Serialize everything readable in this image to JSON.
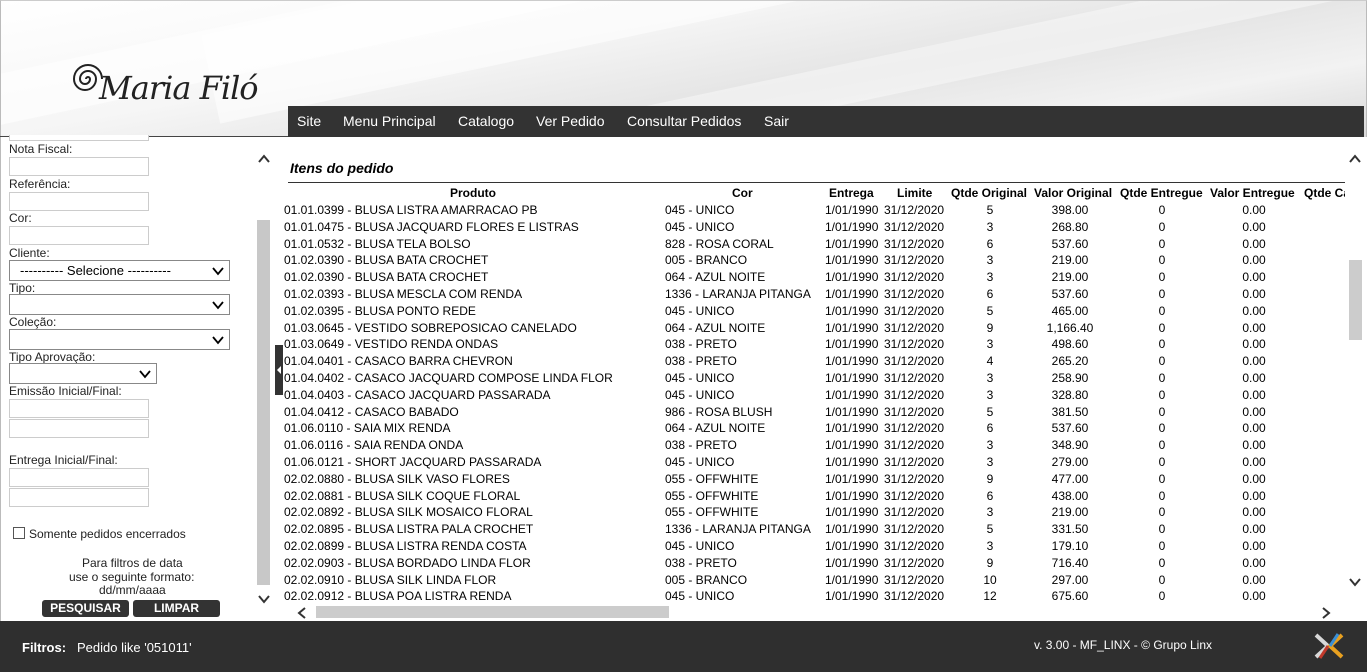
{
  "nav": [
    "Site",
    "Menu Principal",
    "Catalogo",
    "Ver Pedido",
    "Consultar Pedidos",
    "Sair"
  ],
  "logo_text": "Maria Filó",
  "sidebar": {
    "nota_fiscal": "Nota Fiscal:",
    "referencia": "Referência:",
    "cor": "Cor:",
    "cliente": "Cliente:",
    "cliente_value": "---------- Selecione ----------",
    "tipo": "Tipo:",
    "colecao": "Coleção:",
    "tipo_aprovacao": "Tipo Aprovação:",
    "emissao": "Emissão Inicial/Final:",
    "entrega": "Entrega Inicial/Final:",
    "somente": "Somente pedidos encerrados",
    "hint1": "Para filtros de data",
    "hint2": "use o seguinte formato:",
    "hint3": "dd/mm/aaaa",
    "pesquisar": "PESQUISAR",
    "limpar": "LIMPAR"
  },
  "section_title": "Itens do pedido",
  "columns": [
    "Produto",
    "Cor",
    "Entrega",
    "Limite",
    "Qtde Original",
    "Valor Original",
    "Qtde Entregue",
    "Valor Entregue",
    "Qtde Ca"
  ],
  "rows": [
    [
      "01.01.0399 - BLUSA LISTRA AMARRACAO PB",
      "045 - UNICO",
      "1/01/1990",
      "31/12/2020",
      "5",
      "398.00",
      "0",
      "0.00"
    ],
    [
      "01.01.0475 - BLUSA JACQUARD FLORES E LISTRAS",
      "045 - UNICO",
      "1/01/1990",
      "31/12/2020",
      "3",
      "268.80",
      "0",
      "0.00"
    ],
    [
      "01.01.0532 - BLUSA TELA BOLSO",
      "828 - ROSA CORAL",
      "1/01/1990",
      "31/12/2020",
      "6",
      "537.60",
      "0",
      "0.00"
    ],
    [
      "01.02.0390 - BLUSA BATA CROCHET",
      "005 - BRANCO",
      "1/01/1990",
      "31/12/2020",
      "3",
      "219.00",
      "0",
      "0.00"
    ],
    [
      "01.02.0390 - BLUSA BATA CROCHET",
      "064 - AZUL NOITE",
      "1/01/1990",
      "31/12/2020",
      "3",
      "219.00",
      "0",
      "0.00"
    ],
    [
      "01.02.0393 - BLUSA MESCLA COM RENDA",
      "1336 - LARANJA PITANGA",
      "1/01/1990",
      "31/12/2020",
      "6",
      "537.60",
      "0",
      "0.00"
    ],
    [
      "01.02.0395 - BLUSA PONTO REDE",
      "045 - UNICO",
      "1/01/1990",
      "31/12/2020",
      "5",
      "465.00",
      "0",
      "0.00"
    ],
    [
      "01.03.0645 - VESTIDO SOBREPOSICAO CANELADO",
      "064 - AZUL NOITE",
      "1/01/1990",
      "31/12/2020",
      "9",
      "1,166.40",
      "0",
      "0.00"
    ],
    [
      "01.03.0649 - VESTIDO RENDA ONDAS",
      "038 - PRETO",
      "1/01/1990",
      "31/12/2020",
      "3",
      "498.60",
      "0",
      "0.00"
    ],
    [
      "01.04.0401 - CASACO BARRA CHEVRON",
      "038 - PRETO",
      "1/01/1990",
      "31/12/2020",
      "4",
      "265.20",
      "0",
      "0.00"
    ],
    [
      "01.04.0402 - CASACO JACQUARD COMPOSE LINDA FLOR",
      "045 - UNICO",
      "1/01/1990",
      "31/12/2020",
      "3",
      "258.90",
      "0",
      "0.00"
    ],
    [
      "01.04.0403 - CASACO JACQUARD PASSARADA",
      "045 - UNICO",
      "1/01/1990",
      "31/12/2020",
      "3",
      "328.80",
      "0",
      "0.00"
    ],
    [
      "01.04.0412 - CASACO BABADO",
      "986 - ROSA BLUSH",
      "1/01/1990",
      "31/12/2020",
      "5",
      "381.50",
      "0",
      "0.00"
    ],
    [
      "01.06.0110 - SAIA MIX RENDA",
      "064 - AZUL NOITE",
      "1/01/1990",
      "31/12/2020",
      "6",
      "537.60",
      "0",
      "0.00"
    ],
    [
      "01.06.0116 - SAIA RENDA ONDA",
      "038 - PRETO",
      "1/01/1990",
      "31/12/2020",
      "3",
      "348.90",
      "0",
      "0.00"
    ],
    [
      "01.06.0121 - SHORT JACQUARD PASSARADA",
      "045 - UNICO",
      "1/01/1990",
      "31/12/2020",
      "3",
      "279.00",
      "0",
      "0.00"
    ],
    [
      "02.02.0880 - BLUSA SILK VASO FLORES",
      "055 - OFFWHITE",
      "1/01/1990",
      "31/12/2020",
      "9",
      "477.00",
      "0",
      "0.00"
    ],
    [
      "02.02.0881 - BLUSA SILK COQUE FLORAL",
      "055 - OFFWHITE",
      "1/01/1990",
      "31/12/2020",
      "6",
      "438.00",
      "0",
      "0.00"
    ],
    [
      "02.02.0892 - BLUSA SILK MOSAICO FLORAL",
      "055 - OFFWHITE",
      "1/01/1990",
      "31/12/2020",
      "3",
      "219.00",
      "0",
      "0.00"
    ],
    [
      "02.02.0895 - BLUSA LISTRA PALA CROCHET",
      "1336 - LARANJA PITANGA",
      "1/01/1990",
      "31/12/2020",
      "5",
      "331.50",
      "0",
      "0.00"
    ],
    [
      "02.02.0899 - BLUSA LISTRA RENDA COSTA",
      "045 - UNICO",
      "1/01/1990",
      "31/12/2020",
      "3",
      "179.10",
      "0",
      "0.00"
    ],
    [
      "02.02.0903 - BLUSA BORDADO LINDA FLOR",
      "038 - PRETO",
      "1/01/1990",
      "31/12/2020",
      "9",
      "716.40",
      "0",
      "0.00"
    ],
    [
      "02.02.0910 - BLUSA SILK LINDA FLOR",
      "005 - BRANCO",
      "1/01/1990",
      "31/12/2020",
      "10",
      "297.00",
      "0",
      "0.00"
    ],
    [
      "02.02.0912 - BLUSA POA LISTRA RENDA",
      "045 - UNICO",
      "1/01/1990",
      "31/12/2020",
      "12",
      "675.60",
      "0",
      "0.00"
    ]
  ],
  "footer": {
    "filtros_label": "Filtros:",
    "filtros_value": "Pedido like '051011'",
    "version": "v. 3.00 - MF_LINX - © Grupo Linx"
  },
  "colors": {
    "dark": "#333333",
    "footer": "#2f2f2f"
  }
}
